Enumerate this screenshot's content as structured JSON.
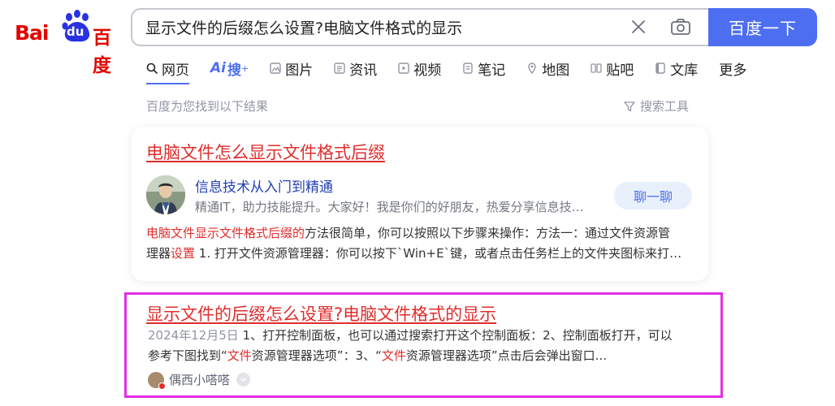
{
  "logo": {
    "bai": "Bai",
    "du": "du",
    "baidu": "百度"
  },
  "search": {
    "value": "显示文件的后缀怎么设置?电脑文件格式的显示",
    "button_label": "百度一下"
  },
  "tabs": [
    {
      "label": "网页",
      "icon": "search-icon",
      "active": true
    },
    {
      "label": "搜",
      "prefix": "Ai",
      "icon": "ai-search-icon",
      "active": false
    },
    {
      "label": "图片",
      "icon": "image-icon",
      "active": false
    },
    {
      "label": "资讯",
      "icon": "news-icon",
      "active": false
    },
    {
      "label": "视频",
      "icon": "video-icon",
      "active": false
    },
    {
      "label": "笔记",
      "icon": "note-icon",
      "active": false
    },
    {
      "label": "地图",
      "icon": "map-pin-icon",
      "active": false
    },
    {
      "label": "贴吧",
      "icon": "tieba-icon",
      "active": false
    },
    {
      "label": "文库",
      "icon": "doc-icon",
      "active": false
    },
    {
      "label": "更多",
      "icon": "",
      "active": false
    }
  ],
  "results_info": {
    "count_text": "百度为您找到以下结果",
    "tools_label": "搜索工具"
  },
  "results": [
    {
      "title": "电脑文件怎么显示文件格式后缀",
      "author": {
        "name": "信息技术从入门到精通",
        "desc": "精通IT，助力技能提升。大家好！我是你们的好朋友，热爱分享信息技…"
      },
      "chat_label": "聊一聊",
      "snippet_line1": {
        "hl": "电脑文件显示文件格式后缀的",
        "text": "方法很简单，你可以按照以下步骤来操作：方法一：通过文件资源管"
      },
      "snippet_line2": {
        "pre": "理器",
        "hl": "设置",
        "text": " 1. 打开文件资源管理器：你可以按下`Win+E`键，或者点击任务栏上的文件夹图标来打…"
      }
    },
    {
      "title": "显示文件的后缀怎么设置?电脑文件格式的显示",
      "date": "2024年12月5日",
      "snippet_line1": " 1、打开控制面板，也可以通过搜索打开这个控制面板：2、控制面板打开，可以",
      "snippet_line2": {
        "a": "参考下图找到“",
        "hl1": "文件",
        "b": "资源管理器选项”：3、“",
        "hl2": "文件",
        "c": "资源管理器选项”点击后会弹出窗口..."
      },
      "source": "偶西小嗒嗒"
    }
  ],
  "colors": {
    "accent": "#4e6ef2",
    "title_red": "#e02d2d",
    "highlight_border": "#e22ee3",
    "link_blue": "#2440b3"
  }
}
